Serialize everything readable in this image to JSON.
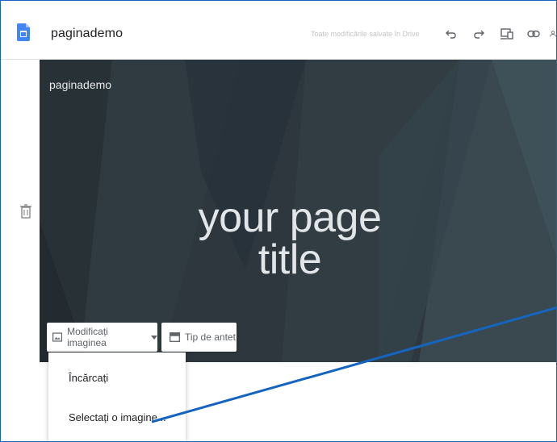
{
  "toolbar": {
    "doc_title": "paginademo",
    "save_status": "Toate modificările salvate în Drive",
    "icons": [
      "undo-icon",
      "redo-icon",
      "preview-icon",
      "link-icon"
    ]
  },
  "header": {
    "site_name": "paginademo",
    "title_line1": "your page",
    "title_line2": "title",
    "change_image_label": "Modificați imaginea",
    "header_type_label": "Tip de antet"
  },
  "image_menu": {
    "items": [
      "Încărcați",
      "Selectați o imagine..."
    ]
  },
  "colors": {
    "banner": "#2f3a40",
    "accent": "#4285f4",
    "callout": "#1565c0"
  }
}
